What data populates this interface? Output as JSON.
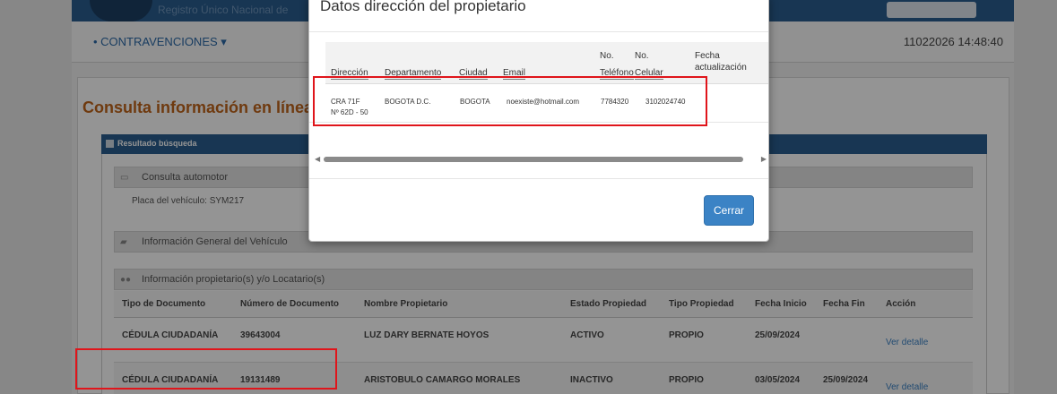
{
  "header": {
    "brand": "Registro Único Nacional de",
    "menu": "• CONTRAVENCIONES ▾",
    "datetime": "11022026 14:48:40"
  },
  "page": {
    "title": "Consulta información en línea",
    "result_bar": "Resultado búsqueda",
    "section_auto": "Consulta automotor",
    "plate": "Placa del vehículo: SYM217",
    "section_vehicle": "Información General del Vehículo",
    "section_owners": "Información propietario(s) y/o Locatario(s)",
    "owners_headers": [
      "Tipo de Documento",
      "Número de Documento",
      "Nombre Propietario",
      "Estado Propiedad",
      "Tipo Propiedad",
      "Fecha Inicio",
      "Fecha Fin",
      "Acción"
    ],
    "owners_rows": [
      [
        "CÉDULA CIUDADANÍA",
        "39643004",
        "LUZ DARY BERNATE HOYOS",
        "ACTIVO",
        "PROPIO",
        "25/09/2024",
        "",
        "Ver detalle"
      ],
      [
        "CÉDULA CIUDADANÍA",
        "19131489",
        "ARISTOBULO CAMARGO MORALES",
        "INACTIVO",
        "PROPIO",
        "03/05/2024",
        "25/09/2024",
        "Ver detalle"
      ]
    ]
  },
  "modal": {
    "title": "Datos dirección del propietario",
    "headers": {
      "direccion": "Dirección",
      "departamento": "Departamento",
      "ciudad": "Ciudad",
      "email": "Email",
      "telefono_1": "No.",
      "telefono_2": "Teléfono",
      "celular_1": "No.",
      "celular_2": "Celular",
      "fecha_1": "Fecha",
      "fecha_2": "actualización"
    },
    "row": {
      "direccion_1": "CRA 71F",
      "direccion_2": "Nº 62D - 50",
      "departamento": "BOGOTA D.C.",
      "ciudad": "BOGOTA",
      "email": "noexiste@hotmail.com",
      "telefono": "7784320",
      "celular": "3102024740",
      "fecha": ""
    },
    "close_label": "Cerrar"
  },
  "colors": {
    "primary": "#2a5d8f",
    "title_orange": "#c0641b",
    "button_blue": "#3b83c5",
    "annotation_red": "#e0151b"
  }
}
